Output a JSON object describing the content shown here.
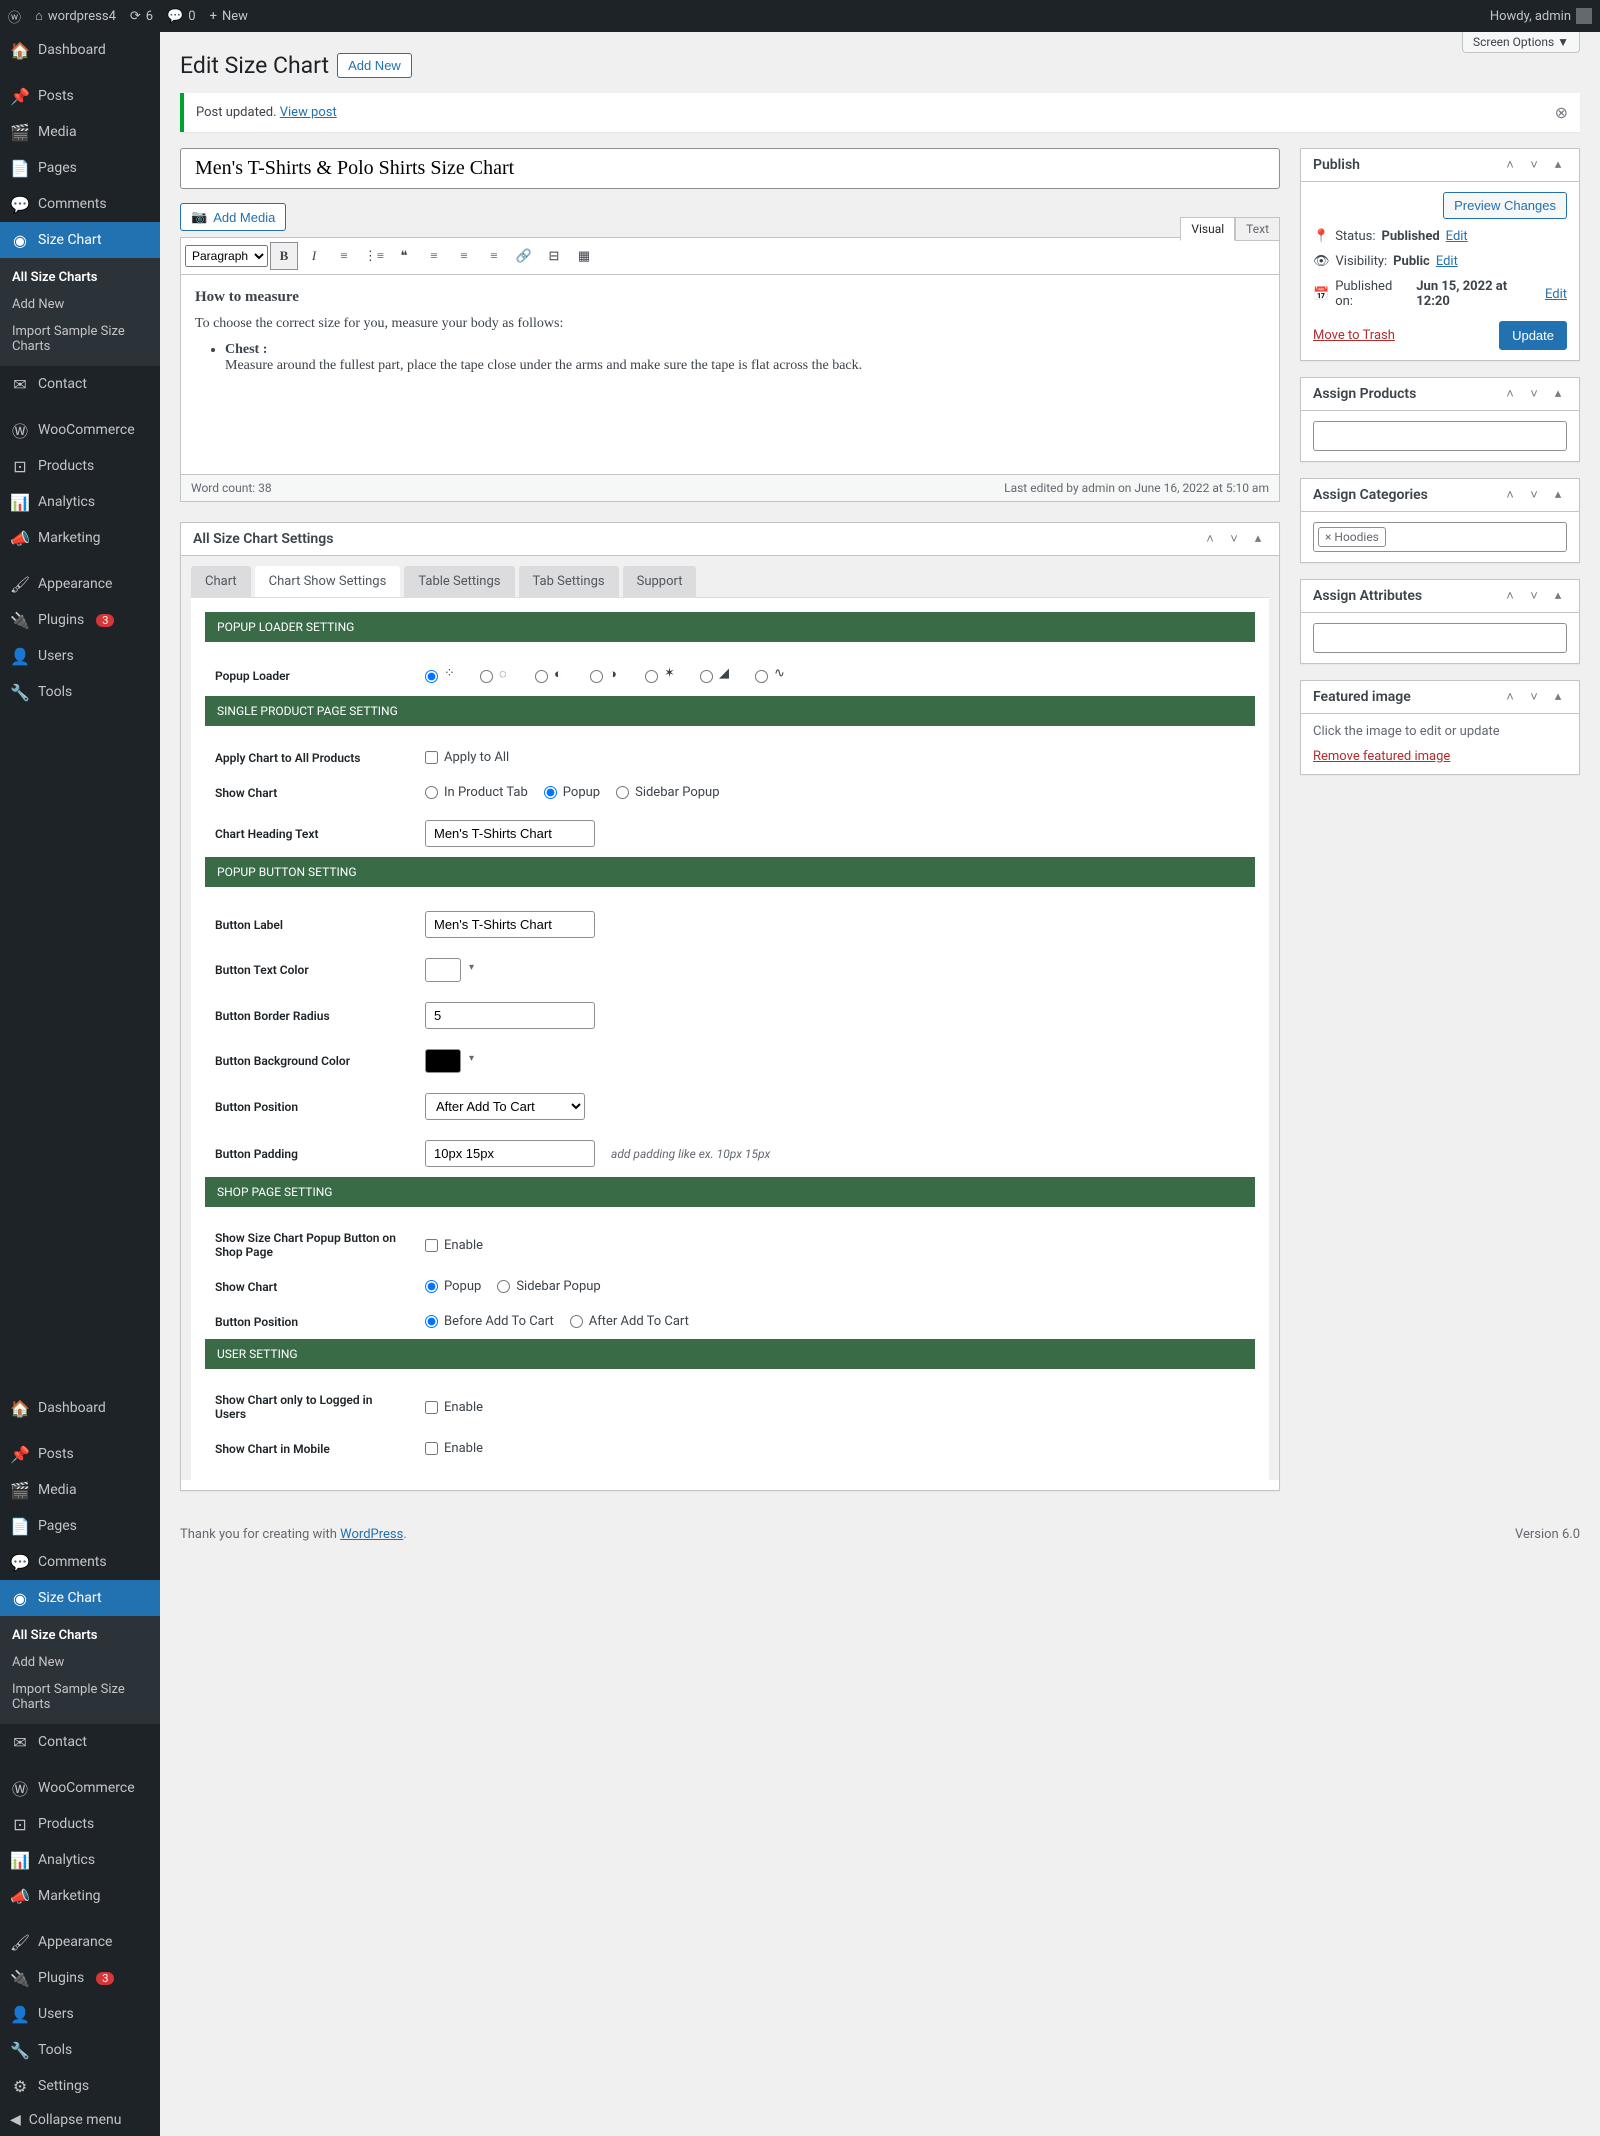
{
  "adminBar": {
    "siteName": "wordpress4",
    "updates": "6",
    "comments": "0",
    "newLabel": "New",
    "howdy": "Howdy, admin"
  },
  "screenOptions": "Screen Options ▼",
  "sidebar": {
    "items": [
      {
        "label": "Dashboard",
        "icon": "⊞"
      },
      {
        "label": "Posts",
        "icon": "📌"
      },
      {
        "label": "Media",
        "icon": "🖼"
      },
      {
        "label": "Pages",
        "icon": "▤"
      },
      {
        "label": "Comments",
        "icon": "💬"
      },
      {
        "label": "Size Chart",
        "icon": "◉",
        "current": true
      },
      {
        "label": "Contact",
        "icon": "✉"
      },
      {
        "label": "WooCommerce",
        "icon": "W"
      },
      {
        "label": "Products",
        "icon": "⊡"
      },
      {
        "label": "Analytics",
        "icon": "📊"
      },
      {
        "label": "Marketing",
        "icon": "📣"
      },
      {
        "label": "Appearance",
        "icon": "🖌"
      },
      {
        "label": "Plugins",
        "icon": "🔌",
        "badge": "3"
      },
      {
        "label": "Users",
        "icon": "👤"
      },
      {
        "label": "Tools",
        "icon": "🔧"
      }
    ],
    "submenu": [
      {
        "label": "All Size Charts",
        "current": true
      },
      {
        "label": "Add New"
      },
      {
        "label": "Import Sample Size Charts"
      }
    ],
    "items2": [
      {
        "label": "Dashboard",
        "icon": "⊞"
      },
      {
        "label": "Posts",
        "icon": "📌"
      },
      {
        "label": "Media",
        "icon": "🖼"
      },
      {
        "label": "Pages",
        "icon": "▤"
      },
      {
        "label": "Comments",
        "icon": "💬"
      },
      {
        "label": "Size Chart",
        "icon": "◉",
        "current": true
      },
      {
        "label": "Contact",
        "icon": "✉"
      },
      {
        "label": "WooCommerce",
        "icon": "W"
      },
      {
        "label": "Products",
        "icon": "⊡"
      },
      {
        "label": "Analytics",
        "icon": "📊"
      },
      {
        "label": "Marketing",
        "icon": "📣"
      },
      {
        "label": "Appearance",
        "icon": "🖌"
      },
      {
        "label": "Plugins",
        "icon": "🔌",
        "badge": "3"
      },
      {
        "label": "Users",
        "icon": "👤"
      },
      {
        "label": "Tools",
        "icon": "🔧"
      },
      {
        "label": "Settings",
        "icon": "⚙"
      }
    ],
    "collapse": "Collapse menu"
  },
  "page": {
    "title": "Edit Size Chart",
    "addNew": "Add New",
    "noticeText": "Post updated.",
    "noticeLink": "View post",
    "postTitle": "Men's T-Shirts & Polo Shirts Size Chart",
    "addMedia": "Add Media",
    "visualTab": "Visual",
    "textTab": "Text",
    "formatSelect": "Paragraph",
    "content": {
      "heading": "How to measure",
      "para": "To choose the correct size for you, measure your body as follows:",
      "itemTitle": "Chest :",
      "itemText": "Measure around the fullest part, place the tape close under the arms and make sure the tape is flat across the back."
    },
    "wordCount": "Word count: 38",
    "lastEdit": "Last edited by admin on June 16, 2022 at 5:10 am"
  },
  "publish": {
    "title": "Publish",
    "preview": "Preview Changes",
    "statusLabel": "Status:",
    "statusValue": "Published",
    "edit": "Edit",
    "visLabel": "Visibility:",
    "visValue": "Public",
    "pubLabel": "Published on:",
    "pubValue": "Jun 15, 2022 at 12:20",
    "trash": "Move to Trash",
    "update": "Update"
  },
  "assignProducts": {
    "title": "Assign Products"
  },
  "assignCategories": {
    "title": "Assign Categories",
    "tag": "× Hoodies"
  },
  "assignAttributes": {
    "title": "Assign Attributes"
  },
  "featuredImage": {
    "title": "Featured image",
    "hint": "Click the image to edit or update",
    "remove": "Remove featured image"
  },
  "settingsBox": {
    "title": "All Size Chart Settings",
    "tabs": [
      "Chart",
      "Chart Show Settings",
      "Table Settings",
      "Tab Settings",
      "Support"
    ],
    "sections": {
      "popupLoader": {
        "head": "POPUP LOADER SETTING",
        "label": "Popup Loader"
      },
      "singleProduct": {
        "head": "SINGLE PRODUCT PAGE SETTING",
        "applyLabel": "Apply Chart to All Products",
        "applyAll": "Apply to All",
        "showChartLabel": "Show Chart",
        "opt1": "In Product Tab",
        "opt2": "Popup",
        "opt3": "Sidebar Popup",
        "headingLabel": "Chart Heading Text",
        "headingValue": "Men's T-Shirts Chart"
      },
      "popupButton": {
        "head": "POPUP BUTTON SETTING",
        "labelLabel": "Button Label",
        "labelValue": "Men's T-Shirts Chart",
        "textColorLabel": "Button Text Color",
        "textColor": "#ffffff",
        "radiusLabel": "Button Border Radius",
        "radiusValue": "5",
        "bgLabel": "Button Background Color",
        "bgColor": "#000000",
        "posLabel": "Button Position",
        "posValue": "After Add To Cart",
        "padLabel": "Button Padding",
        "padValue": "10px 15px",
        "padHint": "add padding like ex. 10px 15px"
      },
      "shopPage": {
        "head": "SHOP PAGE SETTING",
        "showPopupLabel": "Show Size Chart Popup Button on Shop Page",
        "enable": "Enable",
        "showChartLabel": "Show Chart",
        "opt1": "Popup",
        "opt2": "Sidebar Popup",
        "posLabel": "Button Position",
        "posOpt1": "Before Add To Cart",
        "posOpt2": "After Add To Cart"
      },
      "user": {
        "head": "USER SETTING",
        "loggedLabel": "Show Chart only to Logged in Users",
        "mobileLabel": "Show Chart in Mobile",
        "enable": "Enable"
      }
    }
  },
  "footer": {
    "thank": "Thank you for creating with ",
    "wp": "WordPress",
    "version": "Version 6.0"
  }
}
